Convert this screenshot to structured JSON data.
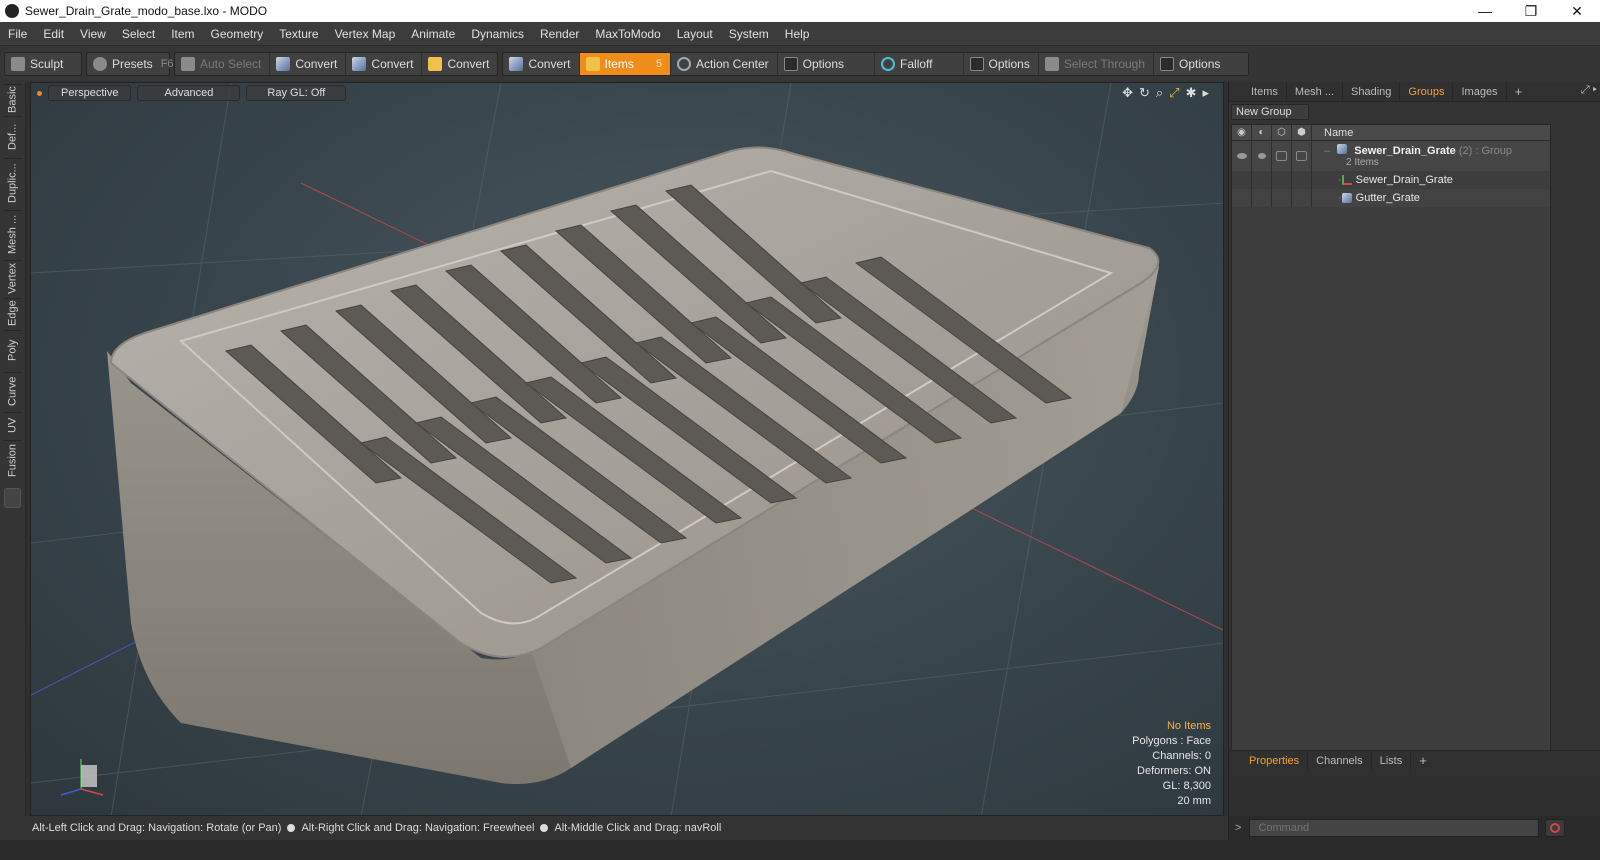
{
  "window": {
    "title": "Sewer_Drain_Grate_modo_base.lxo - MODO",
    "controls": [
      "—",
      "❐",
      "✕"
    ]
  },
  "menu": [
    "File",
    "Edit",
    "View",
    "Select",
    "Item",
    "Geometry",
    "Texture",
    "Vertex Map",
    "Animate",
    "Dynamics",
    "Render",
    "MaxToModo",
    "Layout",
    "System",
    "Help"
  ],
  "toolbar": {
    "sculpt": "Sculpt",
    "presets": "Presets",
    "presets_key": "F6",
    "auto_select": "Auto Select",
    "convert1": "Convert",
    "convert2": "Convert",
    "convert3": "Convert",
    "convert4": "Convert",
    "items": "Items",
    "items_key": "5",
    "action_center": "Action Center",
    "options1": "Options",
    "falloff": "Falloff",
    "options2": "Options",
    "select_through": "Select Through",
    "options3": "Options"
  },
  "left_tabs": [
    "Basic",
    "Def...",
    "Duplic...",
    "Mesh ...",
    "Vertex",
    "Edge",
    "Poly",
    "Curve",
    "UV",
    "Fusion"
  ],
  "viewport": {
    "perspective": "Perspective",
    "advanced": "Advanced",
    "raygl": "Ray GL: Off",
    "stats": {
      "no_items": "No Items",
      "polygons": "Polygons : Face",
      "channels": "Channels: 0",
      "deformers": "Deformers: ON",
      "gl": "GL: 8,300",
      "scale": "20 mm"
    }
  },
  "status": {
    "hint1": "Alt-Left Click and Drag: Navigation: Rotate (or Pan)",
    "hint2": "Alt-Right Click and Drag: Navigation: Freewheel",
    "hint3": "Alt-Middle Click and Drag: navRoll"
  },
  "right_panel": {
    "tabs": [
      "Items",
      "Mesh ...",
      "Shading",
      "Groups",
      "Images"
    ],
    "active_tab": "Groups",
    "new_group": "New Group",
    "name_header": "Name",
    "group": {
      "name": "Sewer_Drain_Grate",
      "count": "(2)",
      "type": ": Group",
      "sub": "2 Items"
    },
    "children": [
      "Sewer_Drain_Grate",
      "Gutter_Grate"
    ],
    "bottom_tabs": [
      "Properties",
      "Channels",
      "Lists"
    ],
    "active_bottom_tab": "Properties",
    "command_placeholder": "Command"
  },
  "colors": {
    "accent": "#f08c1a",
    "active_tab": "#f2a233"
  }
}
